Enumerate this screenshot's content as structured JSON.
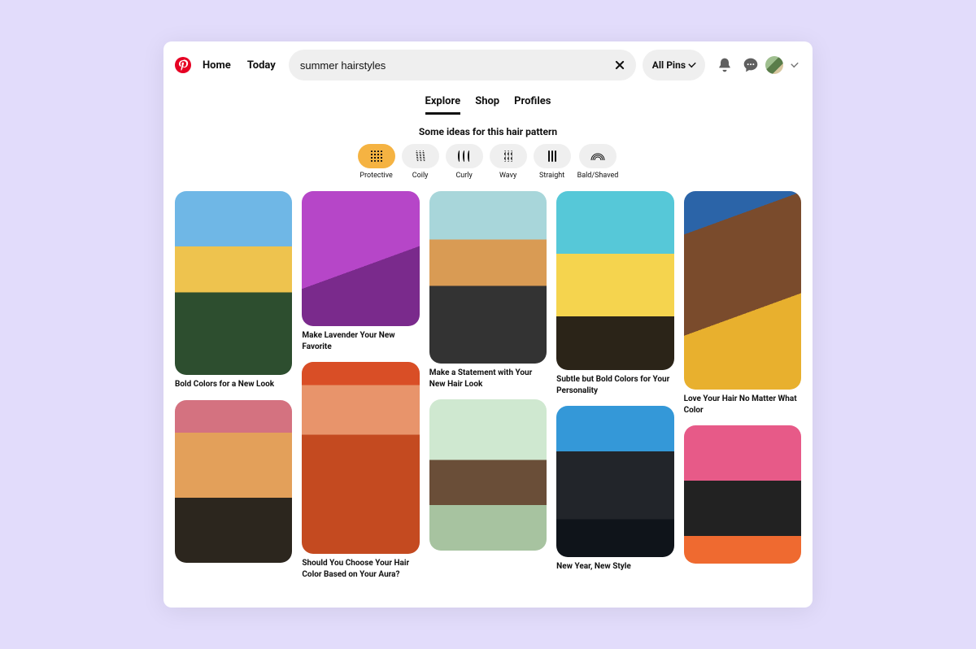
{
  "header": {
    "home": "Home",
    "today": "Today",
    "search_value": "summer hairstyles",
    "filter_label": "All Pins"
  },
  "tabs": {
    "explore": "Explore",
    "shop": "Shop",
    "profiles": "Profiles"
  },
  "subheading": "Some ideas for this hair pattern",
  "chips": [
    {
      "label": "Protective",
      "active": true
    },
    {
      "label": "Coily",
      "active": false
    },
    {
      "label": "Curly",
      "active": false
    },
    {
      "label": "Wavy",
      "active": false
    },
    {
      "label": "Straight",
      "active": false
    },
    {
      "label": "Bald/Shaved",
      "active": false
    }
  ],
  "pins": [
    {
      "title": "Bold Colors for a New Look"
    },
    {
      "title": ""
    },
    {
      "title": "Make Lavender Your New Favorite"
    },
    {
      "title": "Should You Choose Your Hair Color Based on Your Aura?"
    },
    {
      "title": "Make a Statement with Your New Hair Look"
    },
    {
      "title": ""
    },
    {
      "title": "Subtle but Bold Colors for Your Personality"
    },
    {
      "title": "New Year, New Style"
    },
    {
      "title": "Love Your Hair No Matter What Color"
    },
    {
      "title": ""
    }
  ]
}
